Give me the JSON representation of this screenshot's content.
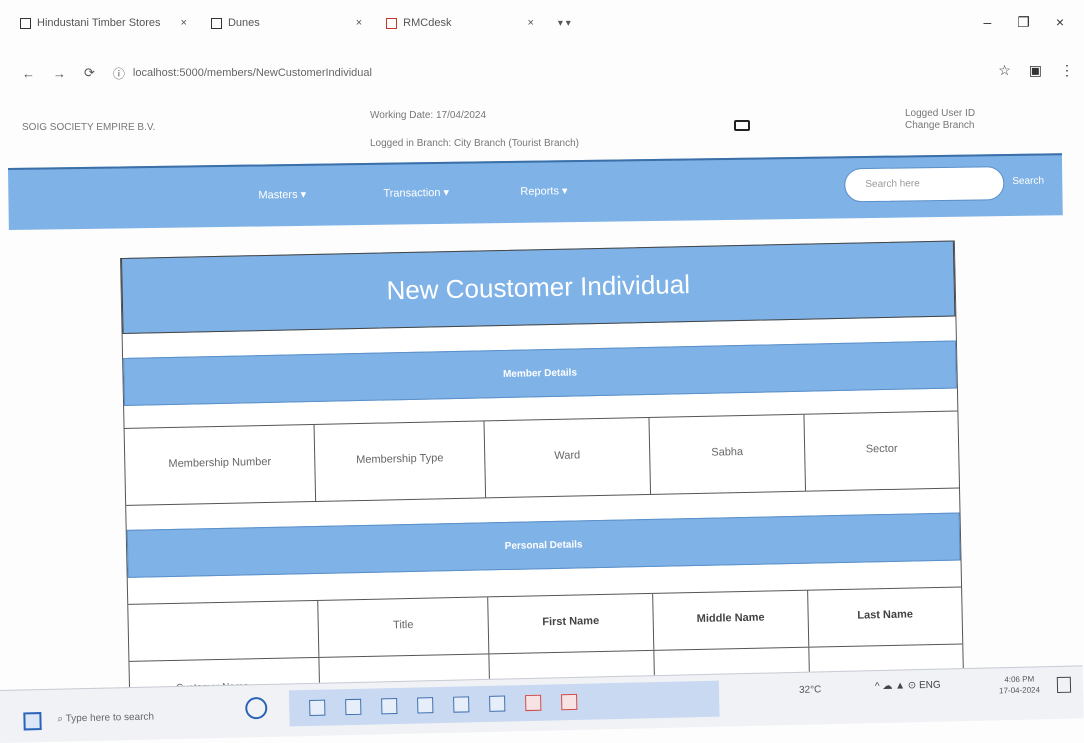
{
  "browser": {
    "tabs": [
      {
        "label": "Hindustani Timber Stores",
        "close": "×"
      },
      {
        "label": "Dunes",
        "close": "×"
      },
      {
        "label": "RMCdesk",
        "close": "×"
      }
    ],
    "tab_arrows": "▾ ▾",
    "window_controls": [
      "–",
      "❐",
      "×"
    ],
    "nav": {
      "back": "←",
      "forward": "→",
      "reload": "⟳"
    },
    "url": "localhost:5000/members/NewCustomerIndividual",
    "addr_icons": [
      "☆",
      "▣",
      "⋮"
    ]
  },
  "header": {
    "brand": "SOIG SOCIETY EMPIRE B.V.",
    "info_line1": "Working Date: 17/04/2024",
    "info_line2": "Logged in Branch: City Branch (Tourist Branch)",
    "user_line1": "Logged User ID",
    "user_line2": "Change Branch"
  },
  "navbar": {
    "menus": [
      "Masters ▾",
      "Transaction ▾",
      "Reports ▾"
    ],
    "search_placeholder": "Search here",
    "search_button": "Search"
  },
  "form": {
    "title": "New Coustomer Individual",
    "member_section": "Member Details",
    "member_columns": [
      "Membership Number",
      "Membership Type",
      "Ward",
      "Sabha",
      "Sector"
    ],
    "personal_section": "Personal Details",
    "personal_columns": [
      "",
      "Title",
      "First Name",
      "Middle Name",
      "Last Name"
    ],
    "row2_label": "Customer Name"
  },
  "taskbar": {
    "search_placeholder": "Type here to search",
    "weather": "32°C",
    "tray": "^ ☁ ▲ ⊙ ENG",
    "clock_time": "4:06 PM",
    "clock_date": "17-04-2024"
  },
  "colors": {
    "primary_blue": "#7fb2e6",
    "border": "#555555",
    "taskbar_highlight": "#c8d9f1"
  }
}
